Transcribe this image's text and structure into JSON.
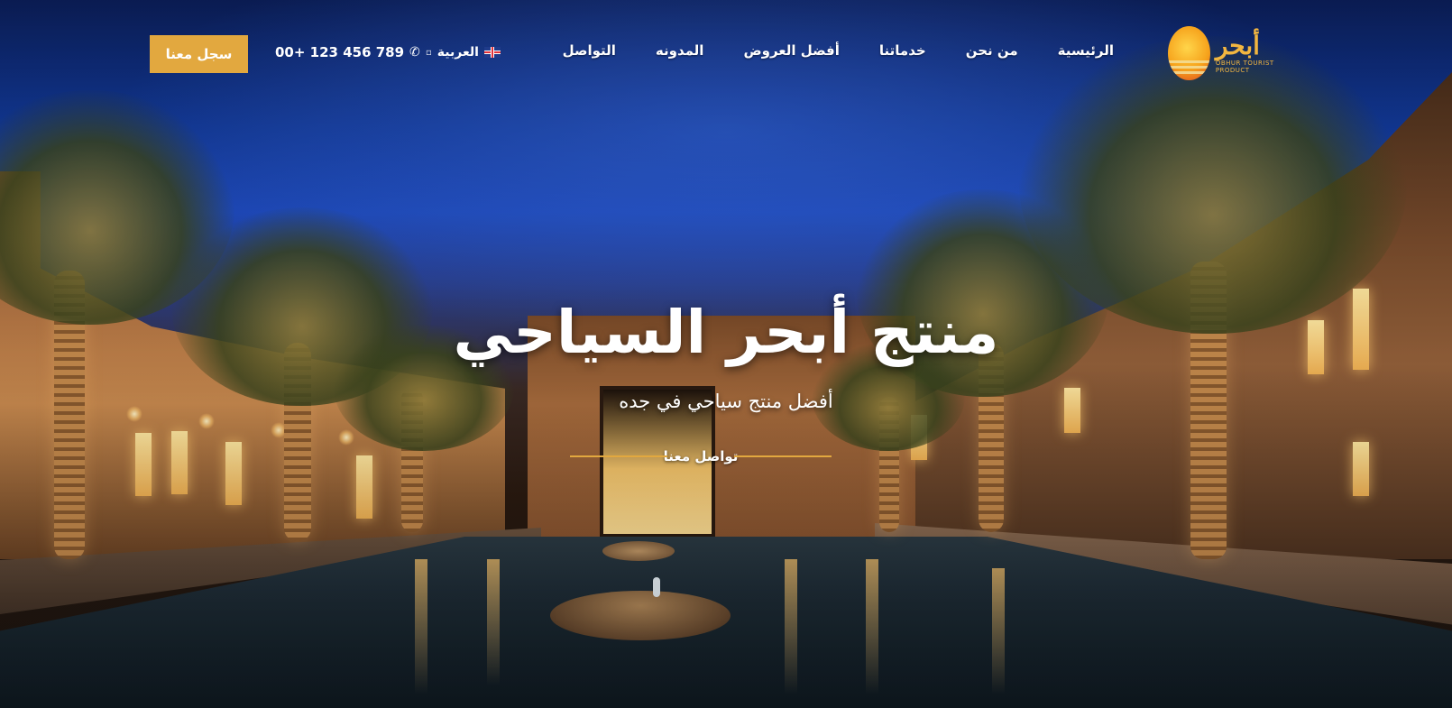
{
  "logo": {
    "arabic": "أبحر",
    "english": "OBHUR TOURIST PRODUCT"
  },
  "nav": {
    "items": [
      {
        "label": "الرئيسية"
      },
      {
        "label": "من نحن"
      },
      {
        "label": "خدماتنا"
      },
      {
        "label": "أفضل العروض"
      },
      {
        "label": "المدونه"
      },
      {
        "label": "التواصل"
      }
    ],
    "language": "العربية",
    "phone": "00+ 123 456 789",
    "register_label": "سجل معنا"
  },
  "hero": {
    "title": "منتج أبحر السياحي",
    "subtitle": "أفضل منتج سياحي في جده",
    "cta_label": "تواصل معنا"
  },
  "colors": {
    "accent": "#e2a83f",
    "text": "#ffffff"
  },
  "icons": {
    "phone": "phone-icon",
    "flag": "uk-flag-icon",
    "caret": "chevron-down-icon"
  }
}
